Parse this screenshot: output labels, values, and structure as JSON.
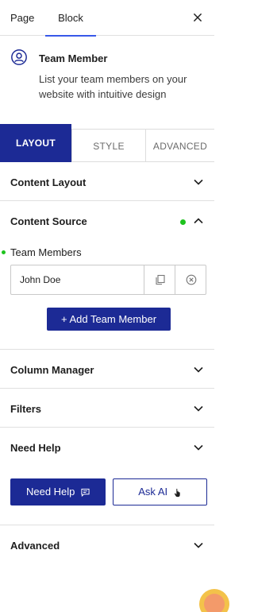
{
  "header": {
    "tabs": [
      "Page",
      "Block"
    ],
    "active_tab": "Block",
    "close_icon": "close-icon"
  },
  "block": {
    "icon": "user-circle-icon",
    "title": "Team Member",
    "description": "List your team members on your website with intuitive design"
  },
  "settings_tabs": {
    "layout": "LAYOUT",
    "style": "STYLE",
    "advanced": "ADVANCED",
    "active": "LAYOUT"
  },
  "panels": {
    "content_layout": "Content Layout",
    "content_source": "Content Source",
    "column_manager": "Column Manager",
    "filters": "Filters",
    "need_help": "Need Help",
    "advanced": "Advanced"
  },
  "content_source": {
    "field_label": "Team Members",
    "items": [
      "John Doe"
    ],
    "add_button": "+ Add Team Member"
  },
  "help": {
    "need_help_button": "Need Help",
    "ask_ai_button": "Ask AI"
  },
  "colors": {
    "primary": "#1c2a95",
    "accent_tab": "#3858e9",
    "status_green": "#1ec31e",
    "border": "#e0e0e0"
  }
}
